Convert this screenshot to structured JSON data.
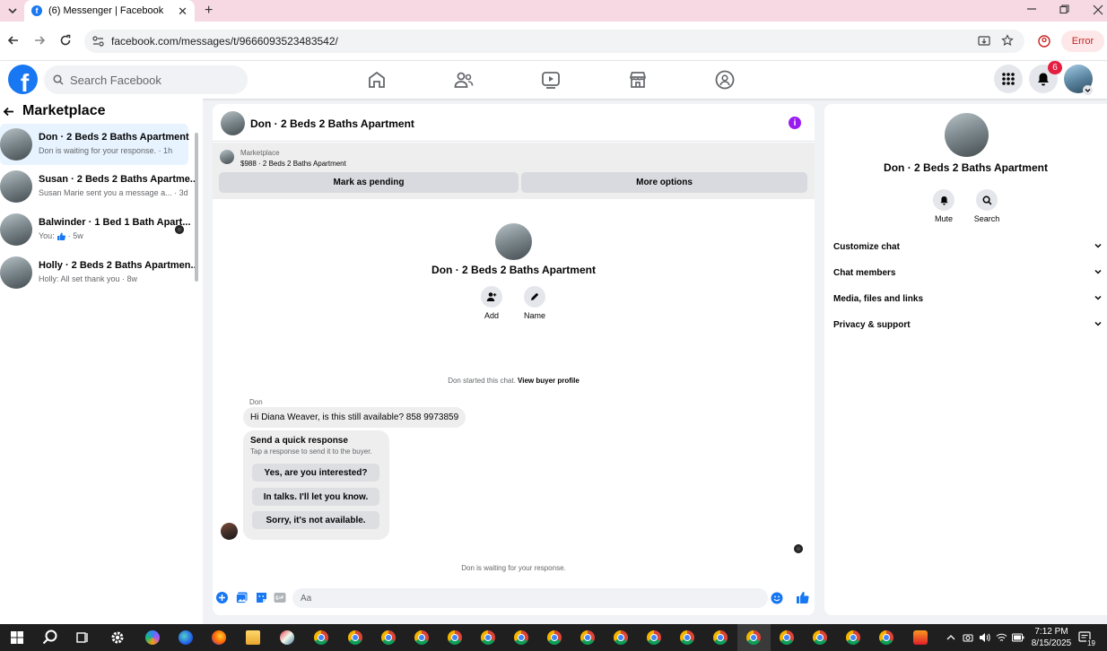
{
  "browser": {
    "tab_title": "(6) Messenger | Facebook",
    "url": "facebook.com/messages/t/9666093523483542/",
    "error_label": "Error"
  },
  "header": {
    "search_placeholder": "Search Facebook",
    "notification_count": "6",
    "brand_color": "#1877f2"
  },
  "sidebar": {
    "title": "Marketplace",
    "conversations": [
      {
        "title": "Don · 2 Beds 2 Baths Apartment",
        "subtitle": "Don is waiting for your response. · 1h"
      },
      {
        "title": "Susan · 2 Beds 2 Baths Apartme...",
        "subtitle": "Susan Marie sent you a message a... · 3d"
      },
      {
        "title": "Balwinder · 1 Bed 1 Bath Apart...",
        "subtitle_prefix": "You:",
        "subtitle_suffix": "· 5w"
      },
      {
        "title": "Holly · 2 Beds 2 Baths Apartmen...",
        "subtitle": "Holly: All set thank you · 8w"
      }
    ]
  },
  "chat": {
    "title": "Don · 2 Beds 2 Baths Apartment",
    "marketplace_label": "Marketplace",
    "item_line": "$988 · 2 Beds 2 Baths Apartment",
    "mark_pending_label": "Mark as pending",
    "more_options_label": "More options",
    "profile_name": "Don · 2 Beds 2 Baths Apartment",
    "add_label": "Add",
    "name_label": "Name",
    "started_text": "Don started this chat.",
    "buyer_profile_link": "View buyer profile",
    "sender_name": "Don",
    "message": "Hi Diana Weaver, is this still available? 858 9973859",
    "quick_title": "Send a quick response",
    "quick_subtitle": "Tap a response to send it to the buyer.",
    "quick_responses": [
      "Yes, are you interested?",
      "In talks. I'll let you know.",
      "Sorry, it's not available."
    ],
    "waiting_text": "Don is waiting for your response.",
    "composer_placeholder": "Aa"
  },
  "details": {
    "name": "Don · 2 Beds 2 Baths Apartment",
    "mute_label": "Mute",
    "search_label": "Search",
    "sections": [
      "Customize chat",
      "Chat members",
      "Media, files and links",
      "Privacy & support"
    ]
  },
  "taskbar": {
    "time": "7:12 PM",
    "date": "8/15/2025",
    "notification_count": "19"
  }
}
